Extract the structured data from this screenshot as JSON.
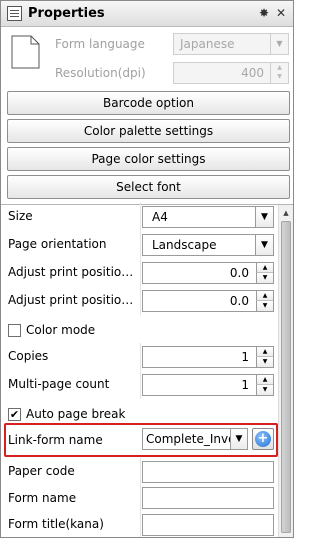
{
  "window": {
    "title": "Properties",
    "pin_icon": "pin-icon",
    "close_icon": "close-icon"
  },
  "top": {
    "form_language_label": "Form language",
    "form_language_value": "Japanese",
    "resolution_label": "Resolution(dpi)",
    "resolution_value": "400"
  },
  "buttons": {
    "barcode": "Barcode option",
    "color_palette": "Color palette settings",
    "page_color": "Page color settings",
    "select_font": "Select font"
  },
  "properties": {
    "size_label": "Size",
    "size_value": "A4",
    "orientation_label": "Page orientation",
    "orientation_value": "Landscape",
    "adjust1_label": "Adjust print position ...",
    "adjust1_value": "0.0",
    "adjust2_label": "Adjust print position ...",
    "adjust2_value": "0.0",
    "color_mode_label": "Color mode",
    "color_mode_checked": false,
    "copies_label": "Copies",
    "copies_value": "1",
    "multipage_label": "Multi-page count",
    "multipage_value": "1",
    "auto_page_break_label": "Auto page break",
    "auto_page_break_checked": true,
    "link_form_label": "Link-form name",
    "link_form_value": "Complete_Invoice",
    "paper_code_label": "Paper code",
    "paper_code_value": "",
    "form_name_label": "Form name",
    "form_name_value": "",
    "form_title_kana_label": "Form title(kana)",
    "form_title_kana_value": ""
  },
  "colors": {
    "highlight": "#d61f1f",
    "add_button": "#1f6fd1"
  }
}
